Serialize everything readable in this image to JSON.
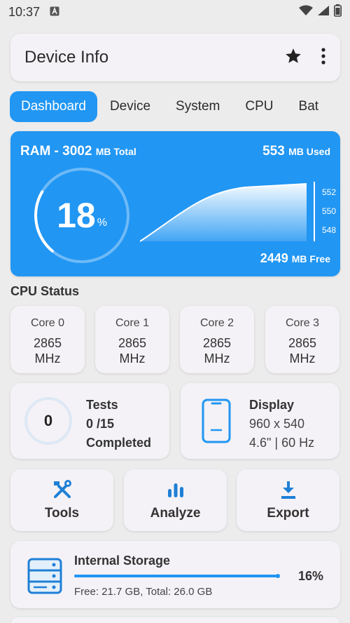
{
  "status_bar": {
    "time": "10:37"
  },
  "appbar": {
    "title": "Device Info"
  },
  "tabs": [
    {
      "label": "Dashboard"
    },
    {
      "label": "Device"
    },
    {
      "label": "System"
    },
    {
      "label": "CPU"
    },
    {
      "label": "Bat"
    }
  ],
  "ram": {
    "title_prefix": "RAM - 3002",
    "title_unit": "MB Total",
    "used_value": "553",
    "used_unit": "MB Used",
    "free_value": "2449",
    "free_unit": "MB Free",
    "percent": "18",
    "percent_sign": "%",
    "percent_fraction": 0.18,
    "axis_ticks": [
      "552",
      "550",
      "548"
    ]
  },
  "cpu_status": {
    "title": "CPU Status",
    "cores": [
      {
        "name": "Core 0",
        "freq": "2865",
        "unit": "MHz"
      },
      {
        "name": "Core 1",
        "freq": "2865",
        "unit": "MHz"
      },
      {
        "name": "Core 2",
        "freq": "2865",
        "unit": "MHz"
      },
      {
        "name": "Core 3",
        "freq": "2865",
        "unit": "MHz"
      }
    ]
  },
  "tests": {
    "count": "0",
    "title": "Tests",
    "progress": "0 /15",
    "status": "Completed"
  },
  "display": {
    "title": "Display",
    "resolution": "960 x 540",
    "details": "4.6\" | 60 Hz"
  },
  "actions": [
    {
      "label": "Tools",
      "icon": "tools-icon"
    },
    {
      "label": "Analyze",
      "icon": "bar-chart-icon"
    },
    {
      "label": "Export",
      "icon": "download-icon"
    }
  ],
  "storage": {
    "title": "Internal Storage",
    "percent": "16%",
    "used_fraction": 0.16,
    "details": "Free: 21.7 GB,  Total: 26.0 GB"
  },
  "colors": {
    "accent": "#2196f3",
    "card": "#f4f2f6",
    "background": "#ececec"
  }
}
